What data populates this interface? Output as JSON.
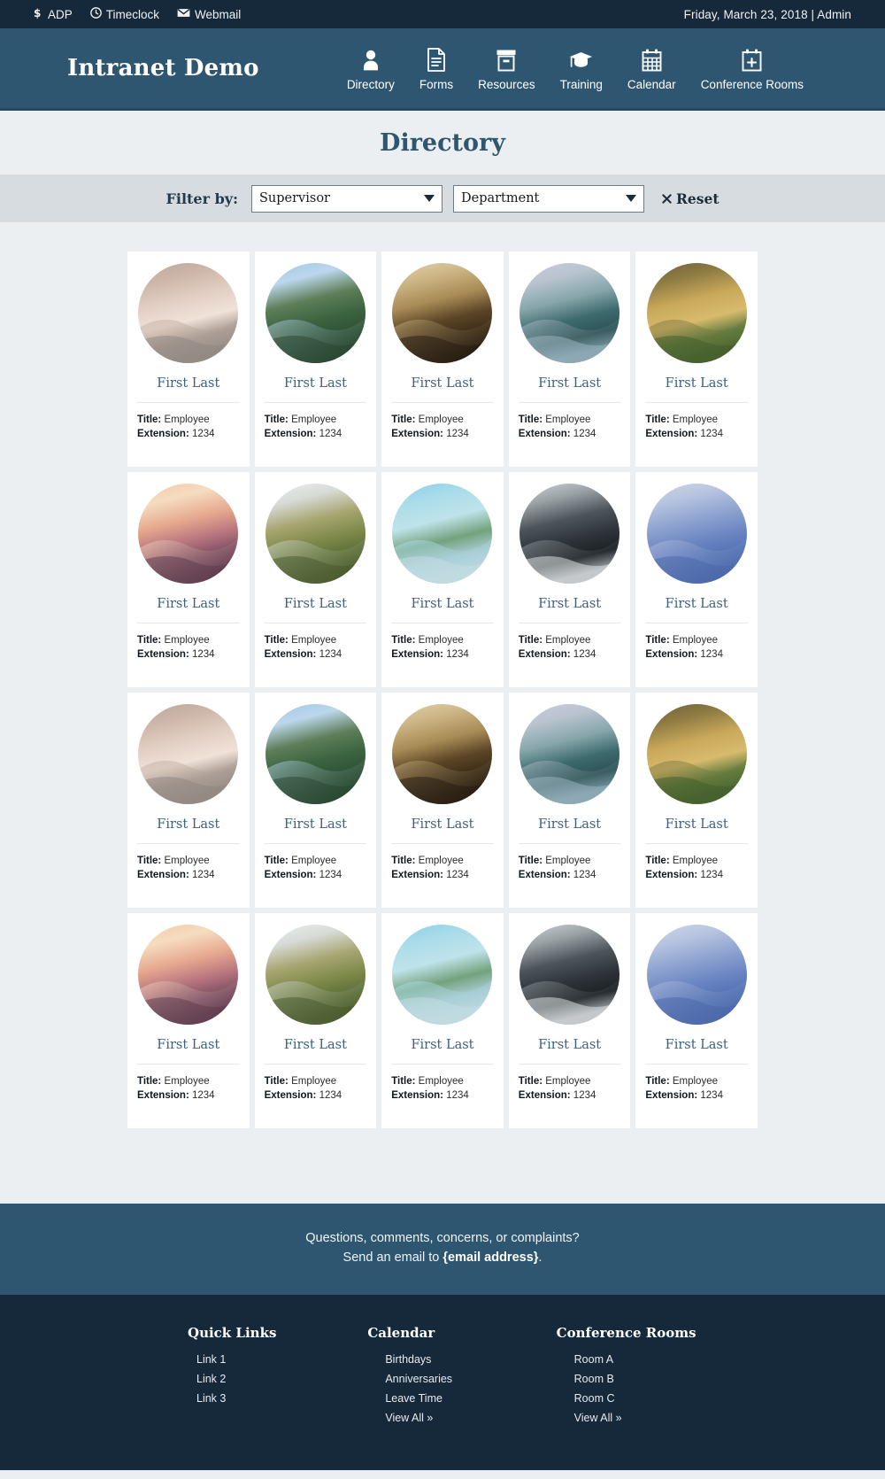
{
  "utility_bar": {
    "links": [
      {
        "icon": "dollar-icon",
        "label": "ADP"
      },
      {
        "icon": "clock-icon",
        "label": "Timeclock"
      },
      {
        "icon": "envelope-icon",
        "label": "Webmail"
      }
    ],
    "status": "Friday, March 23, 2018 | Admin"
  },
  "header": {
    "brand": "Intranet Demo",
    "nav": [
      {
        "icon": "person-icon",
        "label": "Directory"
      },
      {
        "icon": "document-icon",
        "label": "Forms"
      },
      {
        "icon": "archive-icon",
        "label": "Resources"
      },
      {
        "icon": "graduation-cap-icon",
        "label": "Training"
      },
      {
        "icon": "calendar-icon",
        "label": "Calendar"
      },
      {
        "icon": "calendar-plus-icon",
        "label": "Conference Rooms"
      }
    ]
  },
  "page": {
    "title": "Directory"
  },
  "filters": {
    "label": "Filter by:",
    "supervisor": {
      "value": "Supervisor",
      "placeholder": "Supervisor"
    },
    "department": {
      "value": "Department",
      "placeholder": "Department"
    },
    "reset_label": "Reset",
    "reset_icon": "x-icon"
  },
  "directory": {
    "title_label": "Title:",
    "extension_label": "Extension:",
    "cards": [
      {
        "name": "First Last",
        "title": "Employee",
        "extension": "1234",
        "avatar": "a1"
      },
      {
        "name": "First Last",
        "title": "Employee",
        "extension": "1234",
        "avatar": "a2"
      },
      {
        "name": "First Last",
        "title": "Employee",
        "extension": "1234",
        "avatar": "a3"
      },
      {
        "name": "First Last",
        "title": "Employee",
        "extension": "1234",
        "avatar": "a4"
      },
      {
        "name": "First Last",
        "title": "Employee",
        "extension": "1234",
        "avatar": "a5"
      },
      {
        "name": "First Last",
        "title": "Employee",
        "extension": "1234",
        "avatar": "b1"
      },
      {
        "name": "First Last",
        "title": "Employee",
        "extension": "1234",
        "avatar": "b2"
      },
      {
        "name": "First Last",
        "title": "Employee",
        "extension": "1234",
        "avatar": "b3"
      },
      {
        "name": "First Last",
        "title": "Employee",
        "extension": "1234",
        "avatar": "b4"
      },
      {
        "name": "First Last",
        "title": "Employee",
        "extension": "1234",
        "avatar": "b5"
      },
      {
        "name": "First Last",
        "title": "Employee",
        "extension": "1234",
        "avatar": "a1"
      },
      {
        "name": "First Last",
        "title": "Employee",
        "extension": "1234",
        "avatar": "a2"
      },
      {
        "name": "First Last",
        "title": "Employee",
        "extension": "1234",
        "avatar": "a3"
      },
      {
        "name": "First Last",
        "title": "Employee",
        "extension": "1234",
        "avatar": "a4"
      },
      {
        "name": "First Last",
        "title": "Employee",
        "extension": "1234",
        "avatar": "a5"
      },
      {
        "name": "First Last",
        "title": "Employee",
        "extension": "1234",
        "avatar": "b1"
      },
      {
        "name": "First Last",
        "title": "Employee",
        "extension": "1234",
        "avatar": "b2"
      },
      {
        "name": "First Last",
        "title": "Employee",
        "extension": "1234",
        "avatar": "b3"
      },
      {
        "name": "First Last",
        "title": "Employee",
        "extension": "1234",
        "avatar": "b4"
      },
      {
        "name": "First Last",
        "title": "Employee",
        "extension": "1234",
        "avatar": "b5"
      }
    ]
  },
  "contact": {
    "line1": "Questions, comments, concerns, or complaints?",
    "line2_prefix": "Send an email to ",
    "email_label": "{email address}",
    "line2_suffix": "."
  },
  "footer": {
    "columns": [
      {
        "title": "Quick Links",
        "items": [
          {
            "label": "Link 1"
          },
          {
            "label": "Link 2"
          },
          {
            "label": "Link 3"
          }
        ]
      },
      {
        "title": "Calendar",
        "items": [
          {
            "label": "Birthdays"
          },
          {
            "label": "Anniversaries"
          },
          {
            "label": "Leave Time"
          },
          {
            "label": "View All »"
          }
        ]
      },
      {
        "title": "Conference Rooms",
        "items": [
          {
            "label": "Room A"
          },
          {
            "label": "Room B"
          },
          {
            "label": "Room C"
          },
          {
            "label": "View All »"
          }
        ]
      }
    ]
  },
  "colors": {
    "utility_bar_bg": "#16293b",
    "header_bg": "#2f5670",
    "page_bg": "#eceff1",
    "filter_bar_bg": "#d6dce0",
    "card_bg": "#ffffff",
    "accent_title": "#2f5670",
    "name_link": "#3c6080",
    "footer_bg": "#16293b"
  }
}
